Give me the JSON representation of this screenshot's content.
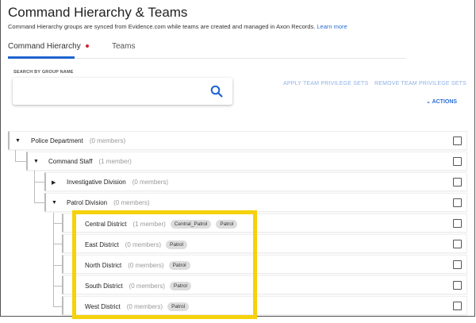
{
  "header": {
    "title": "Command Hierarchy & Teams",
    "subtitle": "Command Hierarchy groups are synced from Evidence.com while teams are created and managed in Axon Records.",
    "learn_more": "Learn more"
  },
  "tabs": [
    {
      "label": "Command Hierarchy",
      "active": true,
      "indicator": "red-dot"
    },
    {
      "label": "Teams",
      "active": false
    }
  ],
  "search": {
    "label": "SEARCH BY GROUP NAME",
    "value": "",
    "placeholder": "",
    "icon": "search-icon"
  },
  "toolbar": {
    "apply": "APPLY TEAM PRIVILEGE SETS",
    "remove": "REMOVE TEAM PRIVILEGE SETS",
    "actions": "ACTIONS"
  },
  "colors": {
    "accent": "#1e63d0",
    "highlight": "#f5d20a",
    "indicator": "#d3232f"
  },
  "tree": [
    {
      "name": "Police Department",
      "members": "(0 members)",
      "expanded": true,
      "chips": []
    },
    {
      "name": "Command Staff",
      "members": "(1 member)",
      "expanded": true,
      "chips": []
    },
    {
      "name": "Investigative Division",
      "members": "(0 members)",
      "expanded": false,
      "chips": []
    },
    {
      "name": "Patrol Division",
      "members": "(0 members)",
      "expanded": true,
      "chips": []
    },
    {
      "name": "Central District",
      "members": "(1 member)",
      "chips": [
        "Central_Patrol",
        "Patrol"
      ]
    },
    {
      "name": "East District",
      "members": "(0 members)",
      "chips": [
        "Patrol"
      ]
    },
    {
      "name": "North District",
      "members": "(0 members)",
      "chips": [
        "Patrol"
      ]
    },
    {
      "name": "South District",
      "members": "(0 members)",
      "chips": [
        "Patrol"
      ]
    },
    {
      "name": "West District",
      "members": "(0 members)",
      "chips": [
        "Patrol"
      ]
    }
  ]
}
